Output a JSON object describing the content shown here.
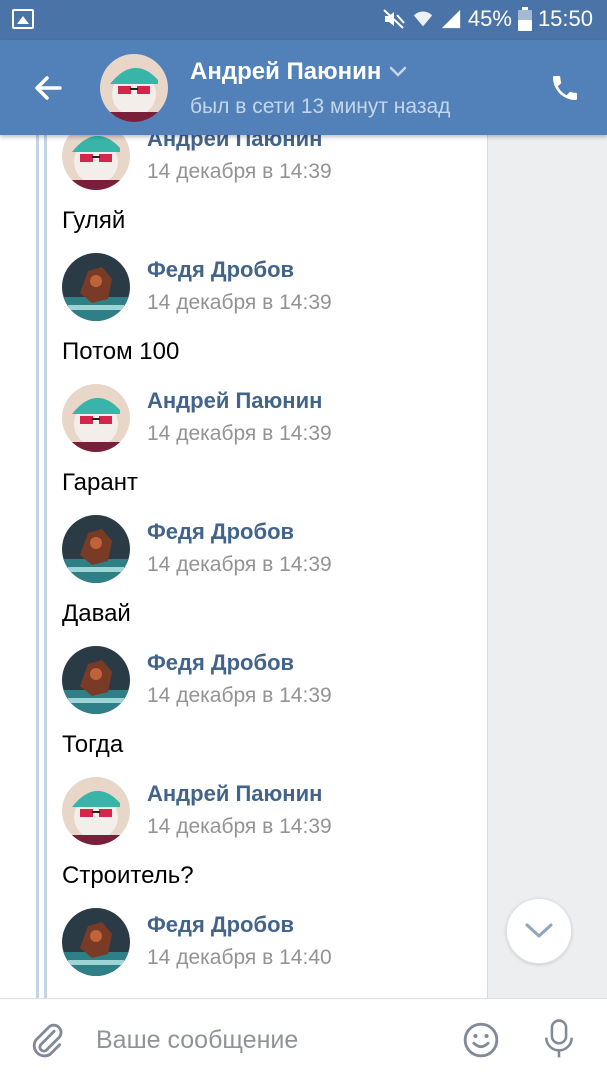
{
  "status_bar": {
    "battery": "45%",
    "time": "15:50",
    "icons": [
      "image-notification-icon",
      "mute-icon",
      "wifi-icon",
      "signal-icon",
      "battery-icon"
    ]
  },
  "header": {
    "title": "Андрей Паюнин",
    "subtitle": "был в сети 13 минут назад",
    "icons": [
      "back-arrow-icon",
      "chevron-down-icon",
      "phone-icon"
    ]
  },
  "messages": [
    {
      "name": "Андрей Паюнин",
      "time": "14 декабря в 14:39",
      "text": "Гуляй",
      "avatar": "andrey"
    },
    {
      "name": "Федя Дробов",
      "time": "14 декабря в 14:39",
      "text": "Потом 100",
      "avatar": "fedya"
    },
    {
      "name": "Андрей Паюнин",
      "time": "14 декабря в 14:39",
      "text": "Гарант",
      "avatar": "andrey"
    },
    {
      "name": "Федя Дробов",
      "time": "14 декабря в 14:39",
      "text": "Давай",
      "avatar": "fedya"
    },
    {
      "name": "Федя Дробов",
      "time": "14 декабря в 14:39",
      "text": "Тогда",
      "avatar": "fedya"
    },
    {
      "name": "Андрей Паюнин",
      "time": "14 декабря в 14:39",
      "text": "Строитель?",
      "avatar": "andrey"
    },
    {
      "name": "Федя Дробов",
      "time": "14 декабря в 14:40",
      "text": "",
      "avatar": "fedya"
    }
  ],
  "input": {
    "placeholder": "Ваше сообщение"
  },
  "colors": {
    "header": "#5181b8",
    "status_bar": "#4a73a8",
    "name": "#42648b",
    "time": "#939393",
    "background": "#edeef0"
  }
}
